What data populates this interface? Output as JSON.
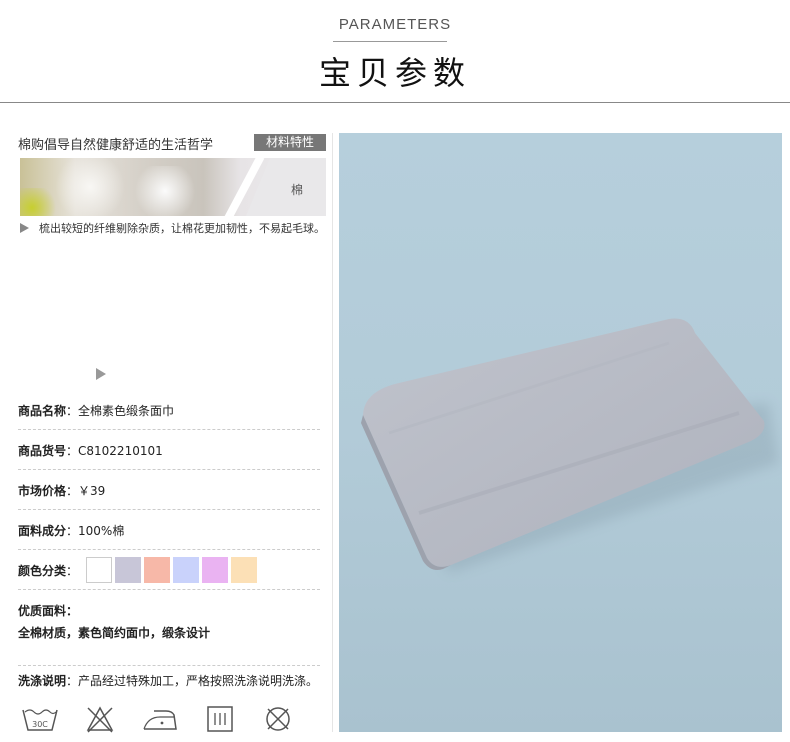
{
  "header": {
    "en_title": "PARAMETERS",
    "cn_title": "宝贝参数"
  },
  "material": {
    "tagline": "棉购倡导自然健康舒适的生活哲学",
    "badge": "材料特性",
    "banner_label": "棉",
    "description": "梳出较短的纤维剔除杂质，让棉花更加韧性，不易起毛球。"
  },
  "specs": {
    "name_key": "商品名称",
    "name_val": "：全棉素色缎条面巾",
    "code_key": "商品货号",
    "code_val": "：C8102210101",
    "price_key": "市场价格",
    "price_val": "：￥39",
    "fabric_key": "面料成分",
    "fabric_val": "：100%棉",
    "color_key": "颜色分类",
    "color_val": "：",
    "quality_key": "优质面料",
    "quality_colon": "：",
    "quality_val": "全棉材质，素色简约面巾，缎条设计",
    "wash_key": "洗涤说明",
    "wash_val": "：产品经过特殊加工，严格按照洗涤说明洗涤。"
  },
  "colors": [
    "#ffffff",
    "#c8c6d8",
    "#f7b8a8",
    "#c9d2fb",
    "#eab3f2",
    "#fce0b6"
  ],
  "care_icons": {
    "wash_temp": "30C",
    "icons": [
      "wash-30c-icon",
      "no-bleach-icon",
      "iron-low-icon",
      "tumble-dry-icon",
      "no-dry-clean-icon"
    ]
  }
}
